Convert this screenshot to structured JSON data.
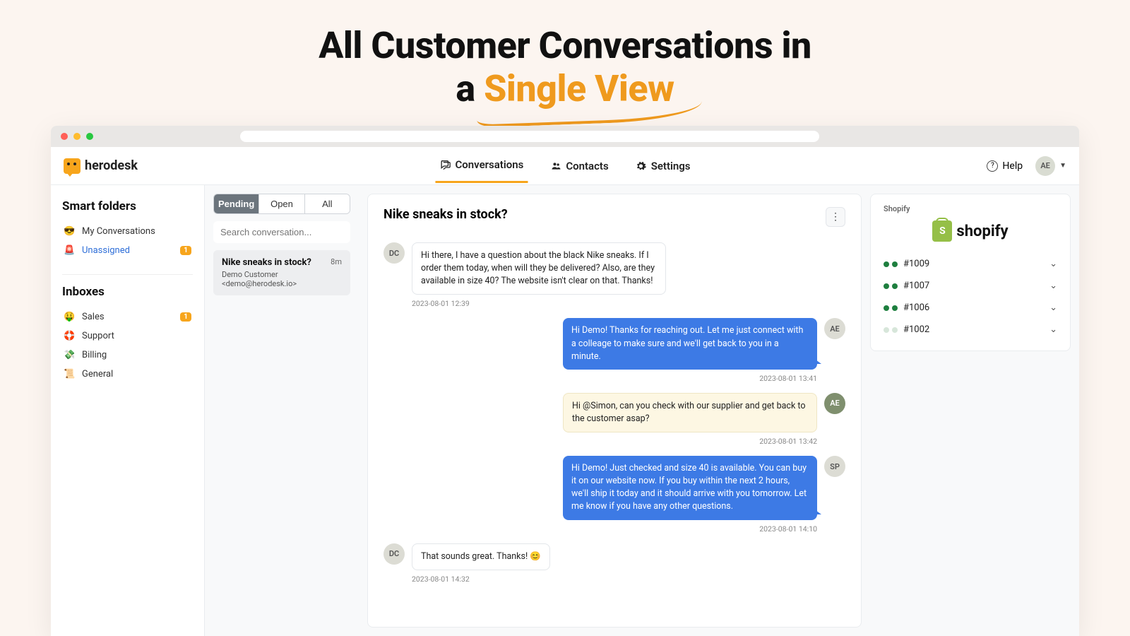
{
  "hero": {
    "line1": "All Customer Conversations in",
    "line2_a": "a ",
    "line2_accent": "Single View"
  },
  "brand": {
    "name": "herodesk"
  },
  "nav": {
    "conversations": "Conversations",
    "contacts": "Contacts",
    "settings": "Settings",
    "help": "Help",
    "avatar": "AE"
  },
  "sidebar": {
    "smart_title": "Smart folders",
    "my_conversations": "My Conversations",
    "unassigned": "Unassigned",
    "unassigned_count": "1",
    "inboxes_title": "Inboxes",
    "items": [
      {
        "emoji": "🤑",
        "label": "Sales",
        "count": "1"
      },
      {
        "emoji": "🛟",
        "label": "Support"
      },
      {
        "emoji": "💸",
        "label": "Billing"
      },
      {
        "emoji": "📜",
        "label": "General"
      }
    ]
  },
  "list": {
    "tabs": {
      "pending": "Pending",
      "open": "Open",
      "all": "All"
    },
    "search_placeholder": "Search conversation...",
    "item": {
      "title": "Nike sneaks in stock?",
      "age": "8m",
      "from": "Demo Customer <demo@herodesk.io>"
    }
  },
  "conversation": {
    "title": "Nike sneaks in stock?",
    "messages": [
      {
        "side": "in",
        "av": "DC",
        "text": "Hi there, I have a question about the black Nike sneaks. If I order them today, when will they be delivered? Also, are they available in size 40? The website isn't clear on that. Thanks!",
        "stamp": "2023-08-01 12:39"
      },
      {
        "side": "out",
        "av": "AE",
        "text": "Hi Demo! Thanks for reaching out. Let me just connect with a colleage to make sure and we'll get back to you in a minute.",
        "stamp": "2023-08-01 13:41",
        "kind": "reply"
      },
      {
        "side": "out",
        "av": "AE",
        "text": "Hi @Simon, can you check with our supplier and get back to the customer asap?",
        "stamp": "2023-08-01 13:42",
        "kind": "note",
        "avclass": "green"
      },
      {
        "side": "out",
        "av": "SP",
        "text": "Hi Demo! Just checked and size 40 is available. You can buy it on our website now. If you buy within the next 2 hours, we'll ship it today and it should arrive with you tomorrow. Let me know if you have any other questions.",
        "stamp": "2023-08-01 14:10",
        "kind": "reply"
      },
      {
        "side": "in",
        "av": "DC",
        "text": "That sounds great. Thanks! 😊",
        "stamp": "2023-08-01 14:32"
      }
    ]
  },
  "shopify": {
    "section_label": "Shopify",
    "brand": "shopify",
    "orders": [
      {
        "id": "#1009",
        "dots": [
          "g",
          "g"
        ]
      },
      {
        "id": "#1007",
        "dots": [
          "g",
          "g"
        ]
      },
      {
        "id": "#1006",
        "dots": [
          "g",
          "g"
        ]
      },
      {
        "id": "#1002",
        "dots": [
          "l",
          "l"
        ]
      }
    ]
  }
}
